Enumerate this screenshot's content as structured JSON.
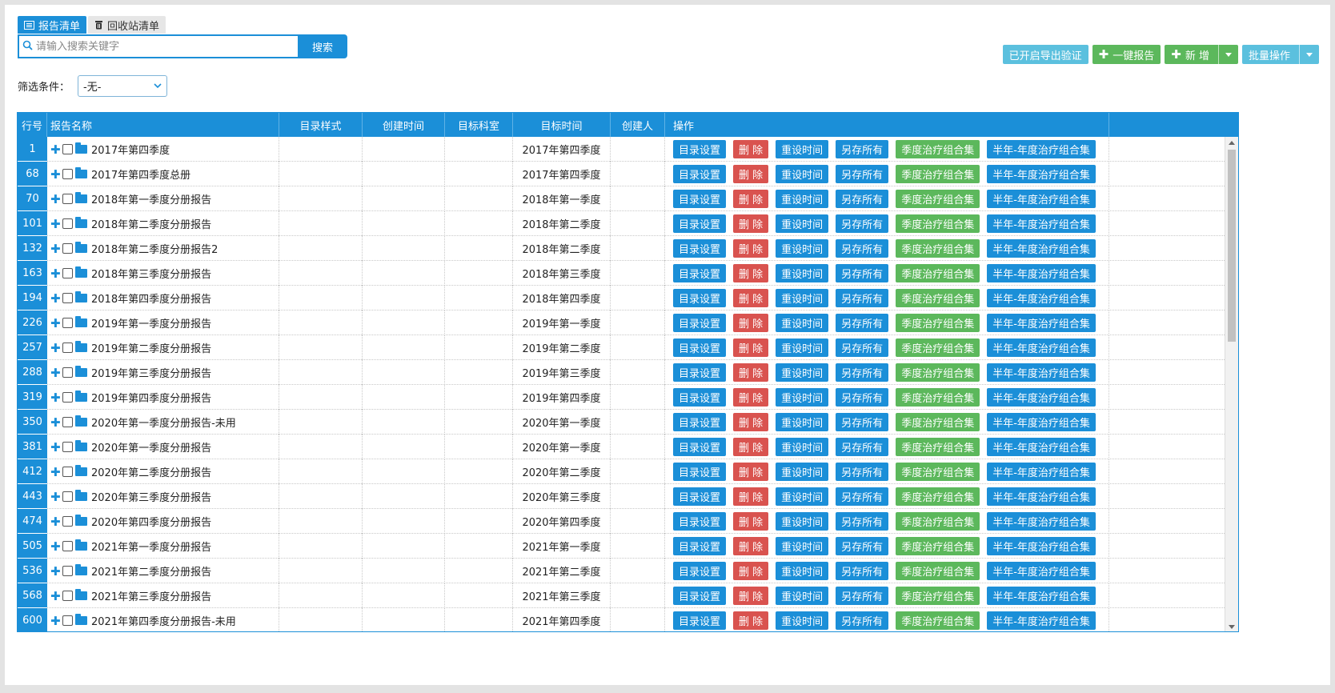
{
  "tabs": [
    {
      "label": "报告清单",
      "icon": "list-icon",
      "active": true
    },
    {
      "label": "回收站清单",
      "icon": "trash-icon",
      "active": false
    }
  ],
  "search": {
    "placeholder": "请输入搜索关键字",
    "button": "搜索"
  },
  "toolbar": {
    "export_verify": "已开启导出验证",
    "one_click_report": "一键报告",
    "add_new": "新 增",
    "batch": "批量操作"
  },
  "filter": {
    "label": "筛选条件：",
    "selected": "-无-"
  },
  "columns": {
    "row_no": "行号",
    "name": "报告名称",
    "catalog_style": "目录样式",
    "created_time": "创建时间",
    "target_dept": "目标科室",
    "target_time": "目标时间",
    "creator": "创建人",
    "actions": "操作"
  },
  "action_labels": {
    "catalog": "目录设置",
    "delete": "删 除",
    "reset_time": "重设时间",
    "save_all": "另存所有",
    "quarter_set": "季度治疗组合集",
    "half_year_set": "半年-年度治疗组合集"
  },
  "rows": [
    {
      "no": "1",
      "name": "2017年第四季度",
      "target_time": "2017年第四季度"
    },
    {
      "no": "68",
      "name": "2017年第四季度总册",
      "target_time": "2017年第四季度"
    },
    {
      "no": "70",
      "name": "2018年第一季度分册报告",
      "target_time": "2018年第一季度"
    },
    {
      "no": "101",
      "name": "2018年第二季度分册报告",
      "target_time": "2018年第二季度"
    },
    {
      "no": "132",
      "name": "2018年第二季度分册报告2",
      "target_time": "2018年第二季度"
    },
    {
      "no": "163",
      "name": "2018年第三季度分册报告",
      "target_time": "2018年第三季度"
    },
    {
      "no": "194",
      "name": "2018年第四季度分册报告",
      "target_time": "2018年第四季度"
    },
    {
      "no": "226",
      "name": "2019年第一季度分册报告",
      "target_time": "2019年第一季度"
    },
    {
      "no": "257",
      "name": "2019年第二季度分册报告",
      "target_time": "2019年第二季度"
    },
    {
      "no": "288",
      "name": "2019年第三季度分册报告",
      "target_time": "2019年第三季度"
    },
    {
      "no": "319",
      "name": "2019年第四季度分册报告",
      "target_time": "2019年第四季度"
    },
    {
      "no": "350",
      "name": "2020年第一季度分册报告-未用",
      "target_time": "2020年第一季度"
    },
    {
      "no": "381",
      "name": "2020年第一季度分册报告",
      "target_time": "2020年第一季度"
    },
    {
      "no": "412",
      "name": "2020年第二季度分册报告",
      "target_time": "2020年第二季度"
    },
    {
      "no": "443",
      "name": "2020年第三季度分册报告",
      "target_time": "2020年第三季度"
    },
    {
      "no": "474",
      "name": "2020年第四季度分册报告",
      "target_time": "2020年第四季度"
    },
    {
      "no": "505",
      "name": "2021年第一季度分册报告",
      "target_time": "2021年第一季度"
    },
    {
      "no": "536",
      "name": "2021年第二季度分册报告",
      "target_time": "2021年第二季度"
    },
    {
      "no": "568",
      "name": "2021年第三季度分册报告",
      "target_time": "2021年第三季度"
    },
    {
      "no": "600",
      "name": "2021年第四季度分册报告-未用",
      "target_time": "2021年第四季度"
    }
  ],
  "colors": {
    "primary": "#1b8fd8",
    "danger": "#d9534f",
    "success": "#5cb85c",
    "info": "#5bc0de"
  }
}
